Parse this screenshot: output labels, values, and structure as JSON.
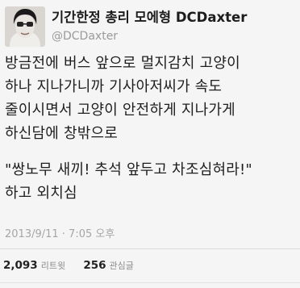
{
  "author": {
    "display_name": "기간한정 총리 모에형 DCDaxter",
    "handle": "@DCDaxter",
    "avatar_icon": "profile-avatar-icon"
  },
  "tweet": {
    "lines": [
      "방금전에 버스 앞으로 멀지감치 고양이",
      "하나 지나가니까 기사아저씨가 속도",
      "줄이시면서 고양이 안전하게 지나가게",
      "하신담에 창밖으로",
      "",
      "\"쌍노무 새끼! 추석 앞두고 차조심혀라!\"",
      "하고 외치심"
    ],
    "timestamp": "2013/9/11 · 7:05 오후"
  },
  "stats": {
    "retweets_count": "2,093",
    "retweets_label": "리트윗",
    "favorites_count": "256",
    "favorites_label": "관심글"
  }
}
